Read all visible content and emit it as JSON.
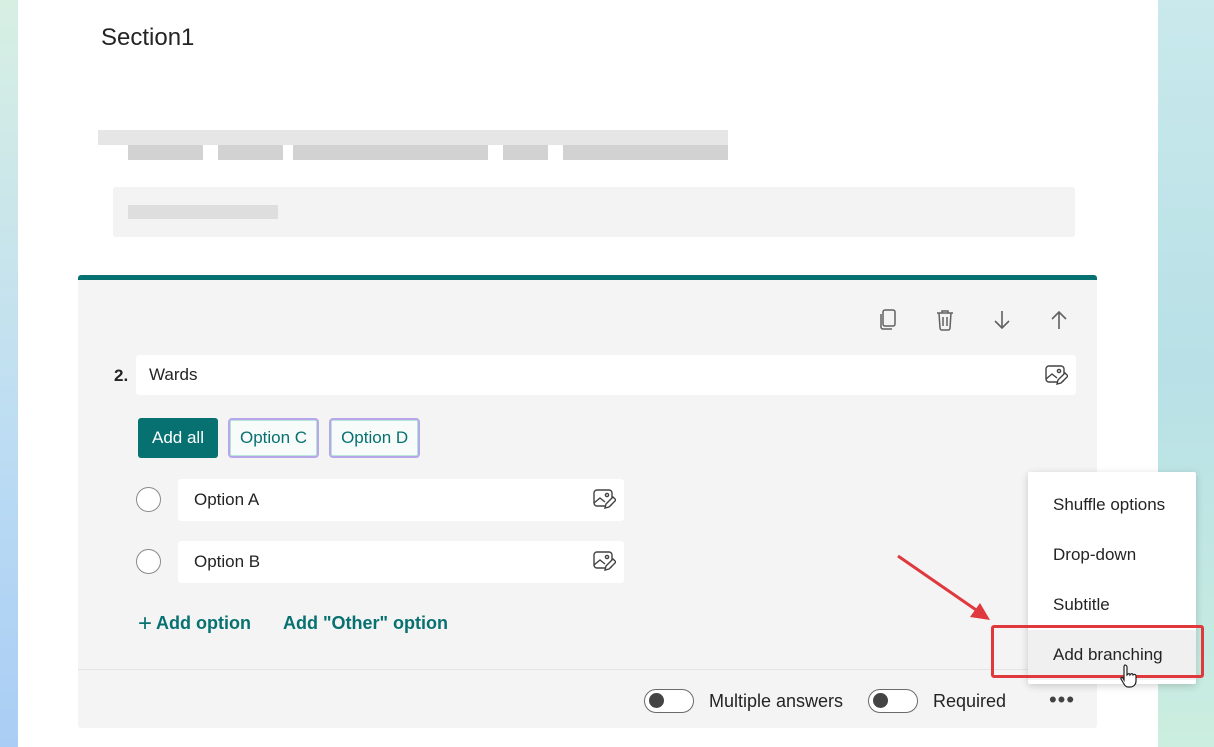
{
  "section": {
    "title": "Section1"
  },
  "question": {
    "number": "2.",
    "title": "Wards",
    "suggestions": {
      "add_all": "Add all",
      "chips": [
        "Option C",
        "Option D"
      ]
    },
    "options": [
      "Option A",
      "Option B"
    ],
    "add_option": "Add option",
    "add_other": "Add \"Other\" option"
  },
  "toolbar": {
    "icons": [
      "copy-icon",
      "delete-icon",
      "move-down-icon",
      "move-up-icon"
    ]
  },
  "footer": {
    "multiple_answers": "Multiple answers",
    "required": "Required",
    "more": "•••"
  },
  "menu": {
    "items": [
      "Shuffle options",
      "Drop-down",
      "Subtitle",
      "Add branching"
    ]
  },
  "colors": {
    "accent": "#077171",
    "highlight": "#e0393d"
  }
}
